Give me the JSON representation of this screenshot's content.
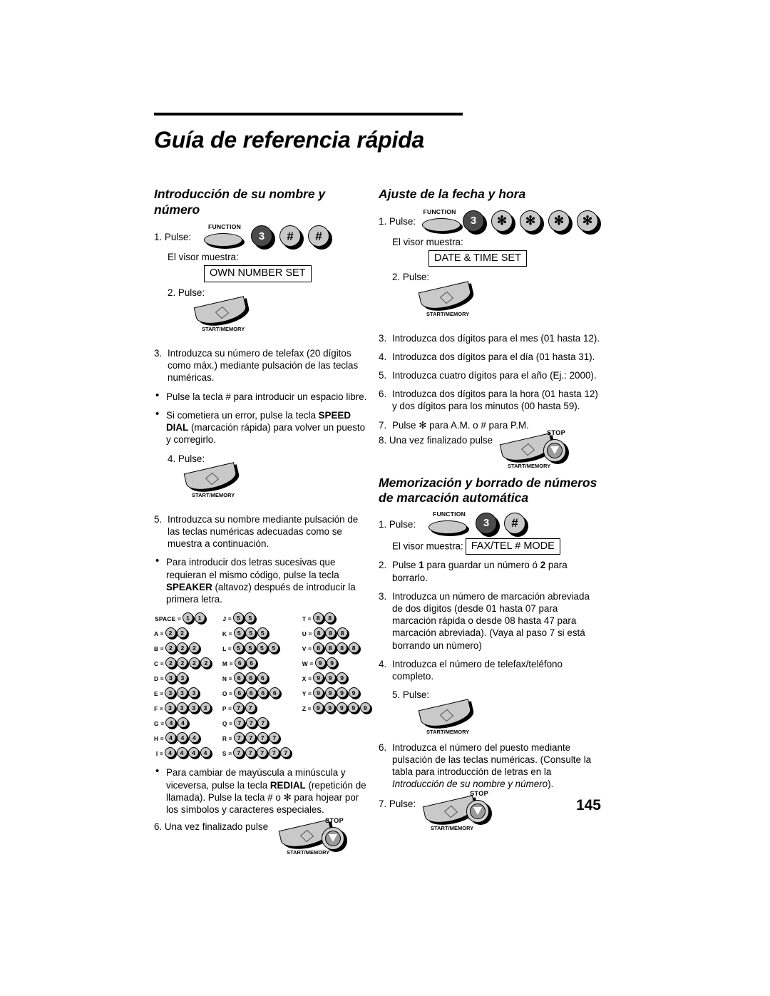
{
  "document": {
    "title": "Guía de referencia rápida",
    "page_number": "145"
  },
  "sections": [
    {
      "id": "nombre-numero",
      "title": "Introducción de su nombre y número",
      "steps": {
        "s1_label": "1. Pulse:",
        "s1_keys": [
          "FUNCTION",
          "3",
          "#",
          "#"
        ],
        "s1_display_label": "El visor muestra:",
        "s1_display_value": "OWN NUMBER SET",
        "s2_label": "2. Pulse:",
        "s2_keys": [
          "START/MEMORY"
        ],
        "s3_num": "3.",
        "s3_text": "Introduzca su número de telefax (20 dígitos como máx.) mediante pulsación de las teclas numéricas.",
        "b1_text_a": "Pulse la tecla # para introducir un espacio libre.",
        "b2_pre": "Si cometiera un error, pulse la tecla ",
        "b2_bold": "SPEED DIAL",
        "b2_post": " (marcación rápida) para volver un puesto y corregirlo.",
        "s4_label": "4. Pulse:",
        "s4_keys": [
          "START/MEMORY"
        ],
        "s5_num": "5.",
        "s5_text": "Introduzca su nombre mediante pulsación de las teclas numéricas adecuadas como se muestra a continuación.",
        "b3_pre": "Para introducir dos letras sucesivas que requieran el mismo código, pulse la tecla ",
        "b3_bold": "SPEAKER",
        "b3_post": " (altavoz) después de introducir la primera letra.",
        "b4_pre": "Para cambiar de mayúscula a minúscula y viceversa, pulse la tecla ",
        "b4_bold": "REDIAL",
        "b4_post": " (repetición de llamada). Pulse la tecla # o ✻ para hojear por los símbolos y caracteres especiales.",
        "s6_label": "6. Una vez finalizado pulse",
        "s6_keys": [
          "START/MEMORY",
          "STOP"
        ]
      },
      "letter_table": [
        [
          {
            "letter": "SPACE =",
            "digits": [
              "1",
              "1"
            ]
          },
          {
            "letter": "A =",
            "digits": [
              "2",
              "2"
            ]
          },
          {
            "letter": "B =",
            "digits": [
              "2",
              "2",
              "2"
            ]
          },
          {
            "letter": "C =",
            "digits": [
              "2",
              "2",
              "2",
              "2"
            ]
          },
          {
            "letter": "D =",
            "digits": [
              "3",
              "3"
            ]
          },
          {
            "letter": "E =",
            "digits": [
              "3",
              "3",
              "3"
            ]
          },
          {
            "letter": "F =",
            "digits": [
              "3",
              "3",
              "3",
              "3"
            ]
          },
          {
            "letter": "G =",
            "digits": [
              "4",
              "4"
            ]
          },
          {
            "letter": "H =",
            "digits": [
              "4",
              "4",
              "4"
            ]
          },
          {
            "letter": "I =",
            "digits": [
              "4",
              "4",
              "4",
              "4"
            ]
          }
        ],
        [
          {
            "letter": "J =",
            "digits": [
              "5",
              "5"
            ]
          },
          {
            "letter": "K =",
            "digits": [
              "5",
              "5",
              "5"
            ]
          },
          {
            "letter": "L =",
            "digits": [
              "5",
              "5",
              "5",
              "5"
            ]
          },
          {
            "letter": "M =",
            "digits": [
              "6",
              "6"
            ]
          },
          {
            "letter": "N =",
            "digits": [
              "6",
              "6",
              "6"
            ]
          },
          {
            "letter": "O =",
            "digits": [
              "6",
              "6",
              "6",
              "6"
            ]
          },
          {
            "letter": "P =",
            "digits": [
              "7",
              "7"
            ]
          },
          {
            "letter": "Q =",
            "digits": [
              "7",
              "7",
              "7"
            ]
          },
          {
            "letter": "R =",
            "digits": [
              "7",
              "7",
              "7",
              "7"
            ]
          },
          {
            "letter": "S =",
            "digits": [
              "7",
              "7",
              "7",
              "7",
              "7"
            ]
          }
        ],
        [
          {
            "letter": "T =",
            "digits": [
              "8",
              "8"
            ]
          },
          {
            "letter": "U =",
            "digits": [
              "8",
              "8",
              "8"
            ]
          },
          {
            "letter": "V =",
            "digits": [
              "8",
              "8",
              "8",
              "8"
            ]
          },
          {
            "letter": "W =",
            "digits": [
              "9",
              "9"
            ]
          },
          {
            "letter": "X =",
            "digits": [
              "9",
              "9",
              "9"
            ]
          },
          {
            "letter": "Y =",
            "digits": [
              "9",
              "9",
              "9",
              "9"
            ]
          },
          {
            "letter": "Z =",
            "digits": [
              "9",
              "9",
              "9",
              "9",
              "9"
            ]
          }
        ]
      ]
    },
    {
      "id": "fecha-hora",
      "title": "Ajuste de la fecha y hora",
      "steps": {
        "s1_label": "1. Pulse:",
        "s1_keys": [
          "FUNCTION",
          "3",
          "✻",
          "✻",
          "✻",
          "✻"
        ],
        "s1_display_label": "El visor muestra:",
        "s1_display_value": "DATE & TIME SET",
        "s2_label": "2. Pulse:",
        "s2_keys": [
          "START/MEMORY"
        ],
        "s3_num": "3.",
        "s3_text": "Introduzca dos dígitos para el mes (01 hasta 12).",
        "s4_num": "4.",
        "s4_text": "Introduzca dos dígitos para el día (01 hasta 31).",
        "s5_num": "5.",
        "s5_text": "Introduzca cuatro dígitos para el año (Ej.: 2000).",
        "s6_num": "6.",
        "s6_text": "Introduzca dos dígitos para la hora (01 hasta 12) y dos dígitos para los minutos (00 hasta 59).",
        "s7_num": "7.",
        "s7_text": "Pulse ✻ para A.M. o # para P.M.",
        "s8_label": "8. Una vez finalizado pulse",
        "s8_keys": [
          "START/MEMORY",
          "STOP"
        ]
      }
    },
    {
      "id": "memorizacion",
      "title": "Memorización y borrado de números de marcación automática",
      "steps": {
        "s1_label": "1. Pulse:",
        "s1_keys": [
          "FUNCTION",
          "3",
          "#"
        ],
        "s1_display_label": "El visor muestra:",
        "s1_display_value": "FAX/TEL # MODE",
        "s2_num": "2.",
        "s2_pre": "Pulse ",
        "s2_b1": "1",
        "s2_mid": " para guardar un número ó ",
        "s2_b2": "2",
        "s2_post": " para borrarlo.",
        "s3_num": "3.",
        "s3_text": "Introduzca un número de marcación abreviada de dos dígitos (desde 01 hasta 07 para marcación rápida o desde 08 hasta 47 para marcación abreviada). (Vaya al paso 7 si está borrando un número)",
        "s4_num": "4.",
        "s4_text": "Introduzca el número de telefax/teléfono completo.",
        "s5_label": "5. Pulse:",
        "s5_keys": [
          "START/MEMORY"
        ],
        "s6_num": "6.",
        "s6_pre": "Introduzca el número del puesto mediante pulsación de las teclas numéricas. (Consulte la tabla para introducción de letras en la ",
        "s6_italic": "Introducción de su nombre y número",
        "s6_post": ").",
        "s7_label": "7. Pulse:",
        "s7_keys": [
          "START/MEMORY",
          "STOP"
        ]
      }
    }
  ],
  "key_captions": {
    "function": "FUNCTION",
    "start_memory": "START/MEMORY",
    "stop": "STOP"
  }
}
